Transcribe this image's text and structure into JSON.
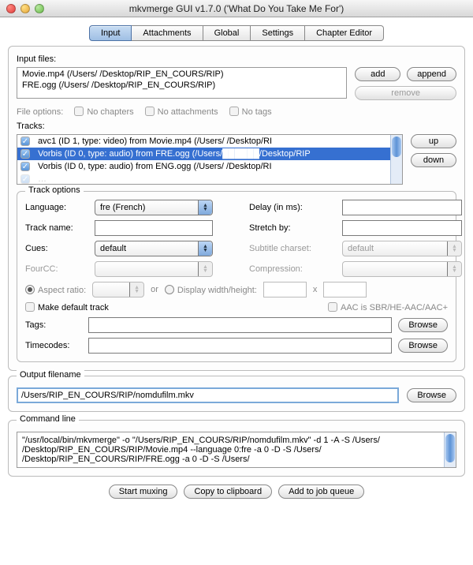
{
  "window": {
    "title": "mkvmerge GUI v1.7.0 ('What Do You Take Me For')"
  },
  "tabs": [
    "Input",
    "Attachments",
    "Global",
    "Settings",
    "Chapter Editor"
  ],
  "active_tab": 0,
  "labels": {
    "input_files": "Input files:",
    "add": "add",
    "append": "append",
    "remove": "remove",
    "file_options": "File options:",
    "no_chapters": "No chapters",
    "no_attachments": "No attachments",
    "no_tags": "No tags",
    "tracks": "Tracks:",
    "up": "up",
    "down": "down",
    "track_options": "Track options",
    "language": "Language:",
    "delay": "Delay (in ms):",
    "track_name": "Track name:",
    "stretch_by": "Stretch by:",
    "cues": "Cues:",
    "subtitle_charset": "Subtitle charset:",
    "fourcc": "FourCC:",
    "compression": "Compression:",
    "aspect_ratio": "Aspect ratio:",
    "or": "or",
    "display_wh": "Display width/height:",
    "x": "x",
    "make_default": "Make default track",
    "aac_sbr": "AAC is SBR/HE-AAC/AAC+",
    "tags": "Tags:",
    "timecodes": "Timecodes:",
    "browse": "Browse",
    "output_filename": "Output filename",
    "command_line": "Command line",
    "start_muxing": "Start muxing",
    "copy_clipboard": "Copy to clipboard",
    "add_to_queue": "Add to job queue"
  },
  "input_files_list": [
    "Movie.mp4 (/Users/          /Desktop/RIP_EN_COURS/RIP)",
    "FRE.ogg (/Users/          /Desktop/RIP_EN_COURS/RIP)"
  ],
  "tracks_list": [
    {
      "checked": true,
      "selected": false,
      "text": "avc1 (ID 1, type: video) from Movie.mp4 (/Users/          /Desktop/RI"
    },
    {
      "checked": true,
      "selected": true,
      "text": "Vorbis (ID 0, type: audio) from FRE.ogg (/Users/██████/Desktop/RIP"
    },
    {
      "checked": true,
      "selected": false,
      "text": "Vorbis (ID 0, type: audio) from ENG.ogg (/Users/          /Desktop/RI"
    }
  ],
  "track_options": {
    "language": "fre (French)",
    "delay": "",
    "track_name": "",
    "stretch_by": "",
    "cues": "default",
    "subtitle_charset": "default",
    "fourcc": "",
    "compression": "",
    "aspect_ratio_on": true,
    "aspect_ratio": "",
    "display_wh_on": false,
    "dw": "",
    "dh": "",
    "make_default": false,
    "aac_sbr": false,
    "tags": "",
    "timecodes": ""
  },
  "output_filename": "/Users/RIP_EN_COURS/RIP/nomdufilm.mkv",
  "command_line": "\"/usr/local/bin/mkvmerge\" -o \"/Users/RIP_EN_COURS/RIP/nomdufilm.mkv\" -d 1 -A -S /Users/          /Desktop/RIP_EN_COURS/RIP/Movie.mp4 --language 0:fre -a 0 -D -S /Users/          /Desktop/RIP_EN_COURS/RIP/FRE.ogg -a 0 -D -S /Users/"
}
